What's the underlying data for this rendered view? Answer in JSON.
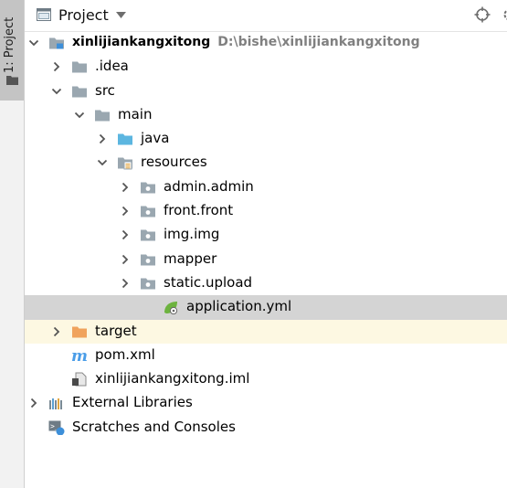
{
  "sidebar": {
    "tab_label": "1: Project"
  },
  "header": {
    "title": "Project"
  },
  "tree": [
    {
      "label": "xinlijiankangxitong",
      "path": "D:\\bishe\\xinlijiankangxitong",
      "depth": 0,
      "arrow": "down",
      "icon": "module-folder-icon",
      "bold": true
    },
    {
      "label": ".idea",
      "depth": 1,
      "arrow": "right",
      "icon": "folder-icon"
    },
    {
      "label": "src",
      "depth": 1,
      "arrow": "down",
      "icon": "folder-icon"
    },
    {
      "label": "main",
      "depth": 2,
      "arrow": "down",
      "icon": "folder-icon"
    },
    {
      "label": "java",
      "depth": 3,
      "arrow": "right",
      "icon": "source-folder-icon"
    },
    {
      "label": "resources",
      "depth": 3,
      "arrow": "down",
      "icon": "resources-folder-icon"
    },
    {
      "label": "admin.admin",
      "depth": 4,
      "arrow": "right",
      "icon": "package-folder-icon"
    },
    {
      "label": "front.front",
      "depth": 4,
      "arrow": "right",
      "icon": "package-folder-icon"
    },
    {
      "label": "img.img",
      "depth": 4,
      "arrow": "right",
      "icon": "package-folder-icon"
    },
    {
      "label": "mapper",
      "depth": 4,
      "arrow": "right",
      "icon": "package-folder-icon"
    },
    {
      "label": "static.upload",
      "depth": 4,
      "arrow": "right",
      "icon": "package-folder-icon"
    },
    {
      "label": "application.yml",
      "depth": 5,
      "arrow": "none",
      "icon": "spring-yml-icon",
      "selected": true
    },
    {
      "label": "target",
      "depth": 1,
      "arrow": "right",
      "icon": "excluded-folder-icon",
      "excluded": true
    },
    {
      "label": "pom.xml",
      "depth": 1,
      "arrow": "none",
      "icon": "maven-icon"
    },
    {
      "label": "xinlijiankangxitong.iml",
      "depth": 1,
      "arrow": "none",
      "icon": "iml-file-icon"
    },
    {
      "label": "External Libraries",
      "depth": 0,
      "arrow": "right",
      "icon": "libraries-icon"
    },
    {
      "label": "Scratches and Consoles",
      "depth": 0,
      "arrow": "none",
      "icon": "scratches-icon"
    }
  ],
  "colors": {
    "folder": "#9aa7b0",
    "source_folder": "#5cb6e0",
    "excluded_folder": "#f0a35d",
    "selection": "#d4d4d4",
    "excluded_row": "#fdf8e2",
    "spring": "#6db33f",
    "maven": "#4a9de8"
  }
}
